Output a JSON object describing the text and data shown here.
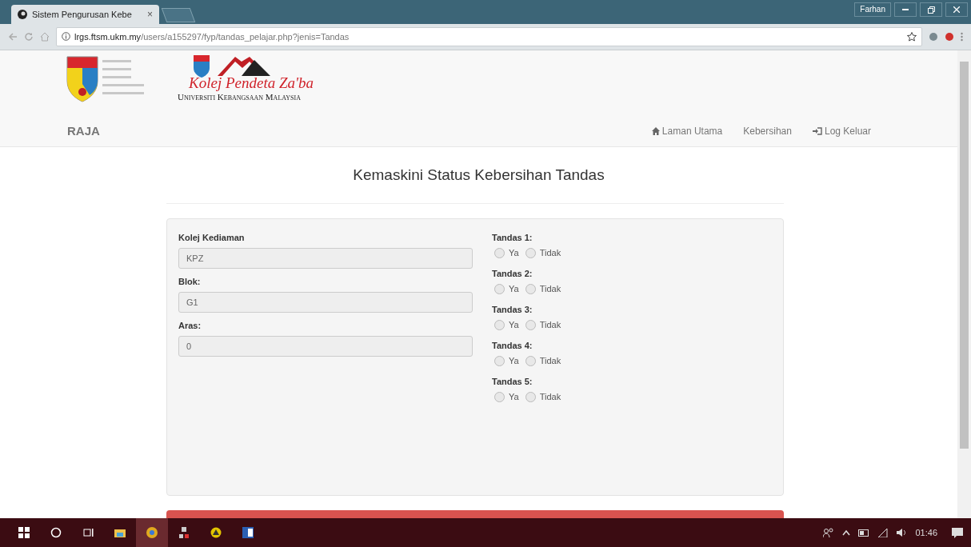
{
  "browser": {
    "tab_title": "Sistem Pengurusan Kebe",
    "tab_close": "×",
    "user": "Farhan",
    "url_domain": "lrgs.ftsm.ukm.my",
    "url_path": "/users/a155297/fyp/tandas_pelajar.php?jenis=Tandas"
  },
  "header": {
    "college_name": "Kolej Pendeta Za'ba",
    "university_name": "Universiti Kebangsaan Malaysia",
    "brand": "RAJA",
    "nav": [
      {
        "label": "Laman Utama",
        "kind": "home"
      },
      {
        "label": "Kebersihan",
        "kind": "plain"
      },
      {
        "label": "Log Keluar",
        "kind": "logout"
      }
    ]
  },
  "page_title": "Kemaskini Status Kebersihan Tandas",
  "fields": [
    {
      "label": "Kolej Kediaman",
      "value": "KPZ"
    },
    {
      "label": "Blok:",
      "value": "G1"
    },
    {
      "label": "Aras:",
      "value": "0"
    }
  ],
  "toilets": [
    {
      "label": "Tandas 1:",
      "options": [
        {
          "label": "Ya",
          "selected": false
        },
        {
          "label": "Tidak",
          "selected": false
        }
      ]
    },
    {
      "label": "Tandas 2:",
      "options": [
        {
          "label": "Ya",
          "selected": false
        },
        {
          "label": "Tidak",
          "selected": false
        }
      ]
    },
    {
      "label": "Tandas 3:",
      "options": [
        {
          "label": "Ya",
          "selected": false
        },
        {
          "label": "Tidak",
          "selected": false
        }
      ]
    },
    {
      "label": "Tandas 4:",
      "options": [
        {
          "label": "Ya",
          "selected": false
        },
        {
          "label": "Tidak",
          "selected": false
        }
      ]
    },
    {
      "label": "Tandas 5:",
      "options": [
        {
          "label": "Ya",
          "selected": false
        },
        {
          "label": "Tidak",
          "selected": false
        }
      ]
    }
  ],
  "taskbar": {
    "clock": "01:46"
  }
}
